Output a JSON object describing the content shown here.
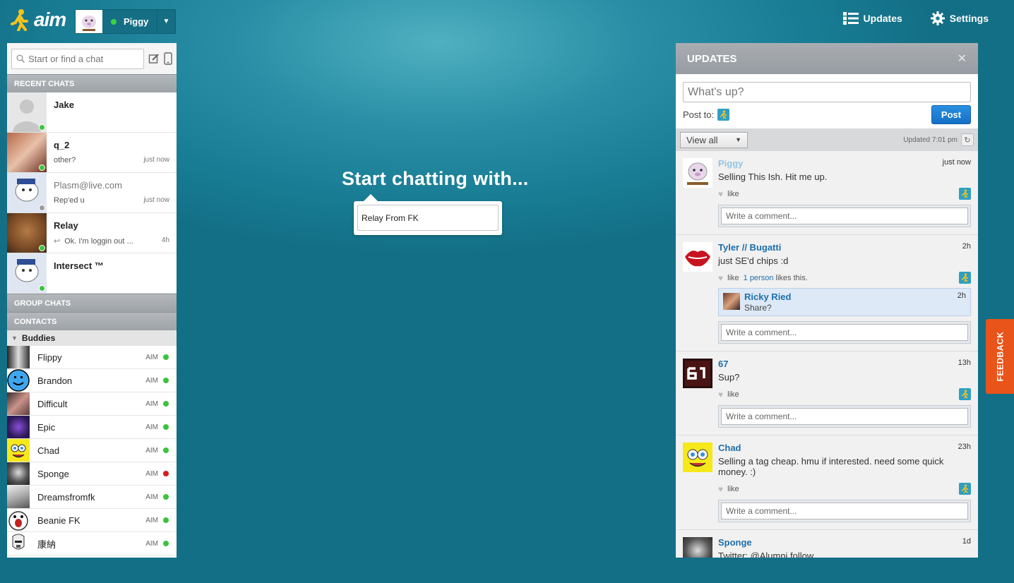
{
  "app": {
    "logo_text": "aim"
  },
  "user": {
    "name": "Piggy"
  },
  "topnav": {
    "updates": "Updates",
    "settings": "Settings"
  },
  "search": {
    "placeholder": "Start or find a chat"
  },
  "sections": {
    "recent": "RECENT CHATS",
    "group": "GROUP CHATS",
    "contacts": "CONTACTS",
    "buddies": "Buddies"
  },
  "recent_chats": [
    {
      "name": "Jake",
      "message": "",
      "time": ""
    },
    {
      "name": "q_2",
      "message": "other?",
      "time": "just now"
    },
    {
      "name": "Plasm@live.com",
      "message": "Rep'ed u",
      "time": "just now"
    },
    {
      "name": "Relay",
      "message": "Ok. I'm loggin out ...",
      "time": "4h"
    },
    {
      "name": "Intersect ™",
      "message": "",
      "time": ""
    }
  ],
  "buddies": [
    {
      "name": "Flippy",
      "service": "AIM",
      "status": "online"
    },
    {
      "name": "Brandon",
      "service": "AIM",
      "status": "online"
    },
    {
      "name": "Difficult",
      "service": "AIM",
      "status": "online"
    },
    {
      "name": "Epic",
      "service": "AIM",
      "status": "online"
    },
    {
      "name": "Chad",
      "service": "AIM",
      "status": "online"
    },
    {
      "name": "Sponge",
      "service": "AIM",
      "status": "busy"
    },
    {
      "name": "Dreamsfromfk",
      "service": "AIM",
      "status": "online"
    },
    {
      "name": "Beanie FK",
      "service": "AIM",
      "status": "online"
    },
    {
      "name": "康納",
      "service": "AIM",
      "status": "online"
    }
  ],
  "center": {
    "title": "Start chatting with...",
    "suggestion": "Relay From FK"
  },
  "updates": {
    "title": "UPDATES",
    "close": "✕",
    "compose_placeholder": "What's up?",
    "post_to": "Post to:",
    "post_button": "Post",
    "filter": "View all",
    "updated": "Updated 7:01 pm",
    "like": "like",
    "comment_placeholder": "Write a comment...",
    "posts": [
      {
        "author": "Piggy",
        "time": "just now",
        "text": "Selling This Ish. Hit me up.",
        "likes_link": "",
        "likes_text": ""
      },
      {
        "author": "Tyler // Bugatti",
        "time": "2h",
        "text": "just SE'd chips :d",
        "likes_link": "1 person",
        "likes_text": "likes this.",
        "reply": {
          "author": "Ricky Ried",
          "text": "Share?",
          "time": "2h"
        }
      },
      {
        "author": "67",
        "time": "13h",
        "text": "Sup?",
        "likes_link": "",
        "likes_text": ""
      },
      {
        "author": "Chad",
        "time": "23h",
        "text": "Selling a tag cheap. hmu if interested. need some quick money. :)",
        "likes_link": "",
        "likes_text": ""
      },
      {
        "author": "Sponge",
        "time": "1d",
        "text": "Twitter: @Alumni follow",
        "likes_link": "",
        "likes_text": ""
      }
    ]
  },
  "feedback": "FEEDBACK",
  "colors": {
    "accent": "#1570c6",
    "online": "#3bc43b",
    "busy": "#d31d1d",
    "feedback": "#e8541a"
  }
}
